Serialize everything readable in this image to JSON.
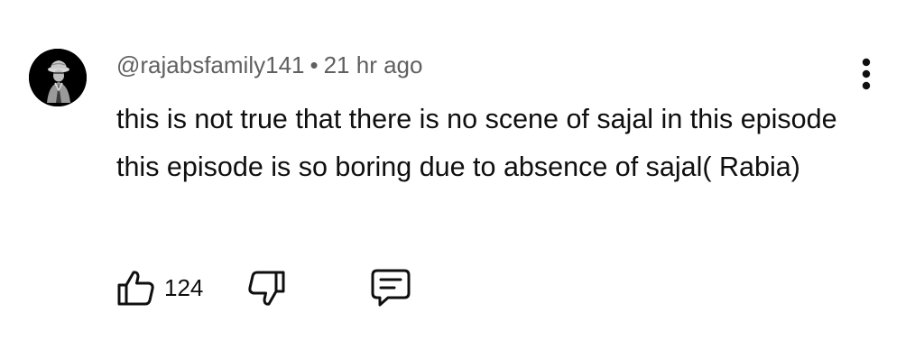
{
  "comment": {
    "author_handle": "@rajabsfamily141",
    "separator": "•",
    "timestamp": "21 hr ago",
    "text": "this is not true that there is no scene of sajal in this episode this episode is so boring due to absence of sajal( Rabia)",
    "like_count": "124"
  },
  "icons": {
    "avatar": "avatar-silhouette",
    "more": "more-vertical-icon",
    "like": "thumbs-up-icon",
    "dislike": "thumbs-down-icon",
    "reply": "comment-icon"
  },
  "colors": {
    "text_primary": "#0f0f0f",
    "text_secondary": "#606060",
    "background": "#ffffff"
  }
}
